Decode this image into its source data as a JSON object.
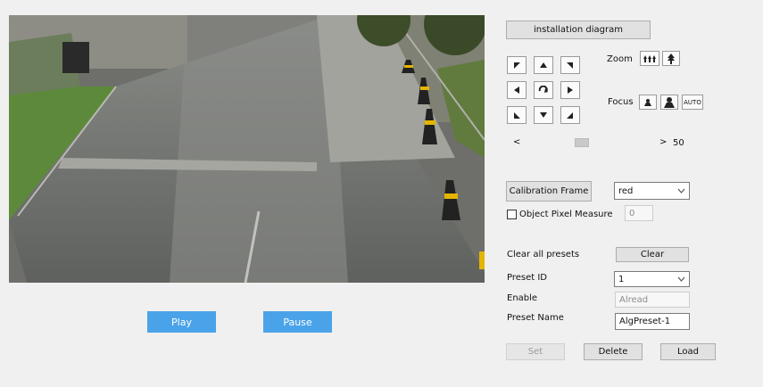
{
  "video": {
    "play_label": "Play",
    "pause_label": "Pause"
  },
  "ptz": {
    "installation_label": "installation diagram",
    "zoom_label": "Zoom",
    "focus_label": "Focus",
    "auto_label": "AUTO",
    "slider_left": "<",
    "slider_right": ">",
    "slider_value": "50",
    "slider_fraction": 0.45
  },
  "calibration": {
    "button_label": "Calibration Frame",
    "color_value": "red",
    "object_pixel_label": "Object Pixel Measure",
    "object_pixel_checked": false,
    "pixel_value": "0"
  },
  "presets": {
    "clear_all_label": "Clear all presets",
    "clear_button": "Clear",
    "preset_id_label": "Preset ID",
    "preset_id_value": "1",
    "enable_label": "Enable",
    "enable_value": "Alread",
    "preset_name_label": "Preset Name",
    "preset_name_value": "AlgPreset-1",
    "set_button": "Set",
    "delete_button": "Delete",
    "load_button": "Load"
  }
}
